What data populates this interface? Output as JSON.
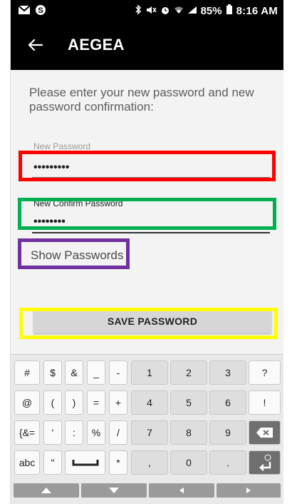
{
  "status_bar": {
    "left_icons": [
      "gmail-icon",
      "skype-icon"
    ],
    "battery": "85%",
    "time": "8:16 AM"
  },
  "app_bar": {
    "title": "AEGEA",
    "back_icon": "arrow-left-icon"
  },
  "form": {
    "instructions": "Please enter your new password and new password confirmation:",
    "new_password": {
      "label": "New Password",
      "value": "•••••••••"
    },
    "confirm_password": {
      "label": "New Confirm Password",
      "value": "••••••••"
    },
    "show_passwords_label": "Show Passwords",
    "save_button_label": "SAVE PASSWORD"
  },
  "annotation_colors": {
    "new_password_box": "#ff0000",
    "confirm_password_box": "#00b050",
    "show_passwords_box": "#7030a0",
    "save_button_box": "#ffff00"
  },
  "keyboard": {
    "row1": [
      "#",
      "$",
      "&",
      "_",
      "-",
      "1",
      "2",
      "3",
      "?"
    ],
    "row2": [
      "@",
      "(",
      ")",
      "=",
      "+",
      "4",
      "5",
      "6",
      "!"
    ],
    "row3": [
      "{&=",
      "'",
      ":",
      "%",
      "/",
      "7",
      "8",
      "9"
    ],
    "row4": [
      "abc",
      "\"",
      "*",
      ",",
      "0",
      "."
    ],
    "backspace_icon": "backspace-icon",
    "space_icon": "space-bar-icon",
    "enter_icon": "enter-icon",
    "nav_icons": [
      "arrow-up-icon",
      "arrow-down-icon",
      "arrow-left-icon",
      "arrow-right-icon"
    ]
  }
}
